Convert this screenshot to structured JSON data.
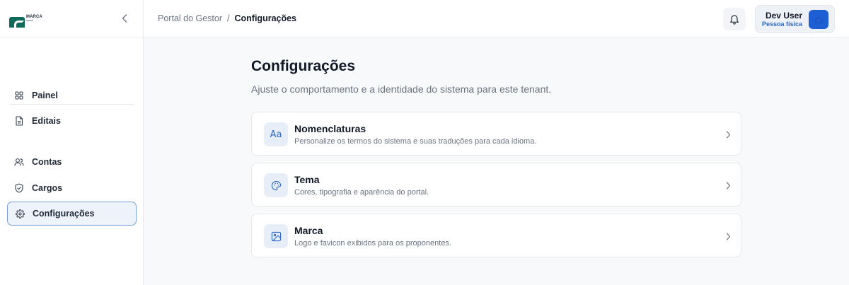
{
  "brand": {
    "logo_text": "MARCA"
  },
  "sidebar": {
    "items": [
      {
        "label": "Painel",
        "icon": "grid-icon"
      },
      {
        "label": "Editais",
        "icon": "document-icon"
      },
      {
        "label": "Contas",
        "icon": "users-icon"
      },
      {
        "label": "Cargos",
        "icon": "shield-icon"
      },
      {
        "label": "Configurações",
        "icon": "gear-icon",
        "active": true
      }
    ]
  },
  "header": {
    "breadcrumb_root": "Portal do Gestor",
    "breadcrumb_separator": "/",
    "breadcrumb_current": "Configurações",
    "user": {
      "name": "Dev User",
      "role": "Pessoa física"
    }
  },
  "main": {
    "title": "Configurações",
    "subtitle": "Ajuste o comportamento e a identidade do sistema para este tenant.",
    "cards": [
      {
        "title": "Nomenclaturas",
        "description": "Personalize os termos do sistema e suas traduções para cada idioma.",
        "icon": "text-aa-icon",
        "icon_glyph": "Aa"
      },
      {
        "title": "Tema",
        "description": "Cores, tipografia e aparência do portal.",
        "icon": "palette-icon"
      },
      {
        "title": "Marca",
        "description": "Logo e favicon exibidos para os proponentes.",
        "icon": "image-icon"
      }
    ]
  },
  "colors": {
    "accent": "#2f67c9",
    "active_border": "#7ba0d9",
    "active_bg": "#eef3fb",
    "logo_green": "#0e6b5a",
    "avatar_blue": "#1f5fd6"
  }
}
